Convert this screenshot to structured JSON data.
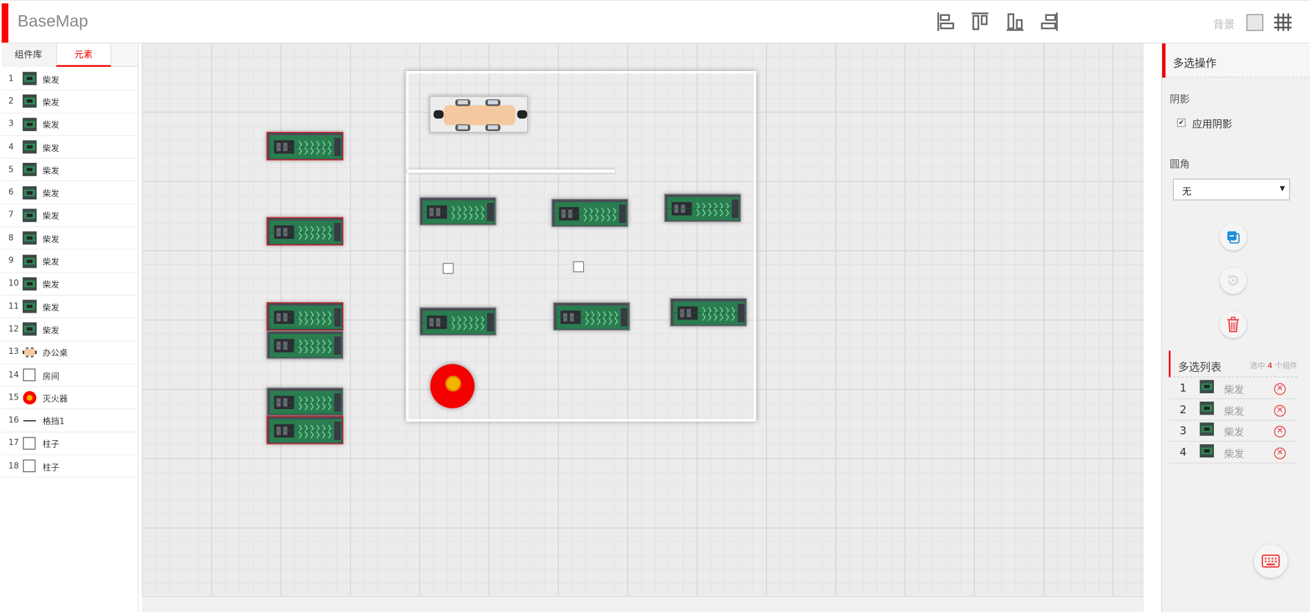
{
  "app": {
    "title": "BaseMap"
  },
  "toolbar": {
    "align_tools": [
      "align-left-icon",
      "align-top-icon",
      "align-bottom-icon",
      "align-right-icon"
    ],
    "background_label": "背景",
    "grid_icon": "grid-icon"
  },
  "left_panel": {
    "tabs": [
      {
        "label": "组件库",
        "active": false
      },
      {
        "label": "元素",
        "active": true
      }
    ],
    "elements": [
      {
        "index": "1",
        "name": "柴发",
        "icon": "generator"
      },
      {
        "index": "2",
        "name": "柴发",
        "icon": "generator"
      },
      {
        "index": "3",
        "name": "柴发",
        "icon": "generator"
      },
      {
        "index": "4",
        "name": "柴发",
        "icon": "generator"
      },
      {
        "index": "5",
        "name": "柴发",
        "icon": "generator"
      },
      {
        "index": "6",
        "name": "柴发",
        "icon": "generator"
      },
      {
        "index": "7",
        "name": "柴发",
        "icon": "generator"
      },
      {
        "index": "8",
        "name": "柴发",
        "icon": "generator"
      },
      {
        "index": "9",
        "name": "柴发",
        "icon": "generator"
      },
      {
        "index": "10",
        "name": "柴发",
        "icon": "generator"
      },
      {
        "index": "11",
        "name": "柴发",
        "icon": "generator"
      },
      {
        "index": "12",
        "name": "柴发",
        "icon": "generator"
      },
      {
        "index": "13",
        "name": "办公桌",
        "icon": "desk"
      },
      {
        "index": "14",
        "name": "房间",
        "icon": "square"
      },
      {
        "index": "15",
        "name": "灭火器",
        "icon": "extinguisher"
      },
      {
        "index": "16",
        "name": "格挡1",
        "icon": "line"
      },
      {
        "index": "17",
        "name": "柱子",
        "icon": "square"
      },
      {
        "index": "18",
        "name": "柱子",
        "icon": "square"
      }
    ]
  },
  "right_panel": {
    "title": "多选操作",
    "shadow_label": "阴影",
    "apply_shadow_label": "应用阴影",
    "apply_shadow_checked": true,
    "corner_label": "圆角",
    "corner_value": "无",
    "actions": [
      "copy-icon",
      "reset-icon",
      "trash-icon"
    ],
    "multi_list_title": "多选列表",
    "selected_prefix": "选中",
    "selected_count": "4",
    "selected_suffix": "个组件",
    "selected_items": [
      {
        "index": "1",
        "name": "柴发"
      },
      {
        "index": "2",
        "name": "柴发"
      },
      {
        "index": "3",
        "name": "柴发"
      },
      {
        "index": "4",
        "name": "柴发"
      }
    ],
    "keyboard_icon": "keyboard-icon"
  },
  "colors": {
    "accent": "#ff0000",
    "extinguisher": "#f50000",
    "generator": "#4a4b57",
    "generator_green": "#2f8a55"
  }
}
